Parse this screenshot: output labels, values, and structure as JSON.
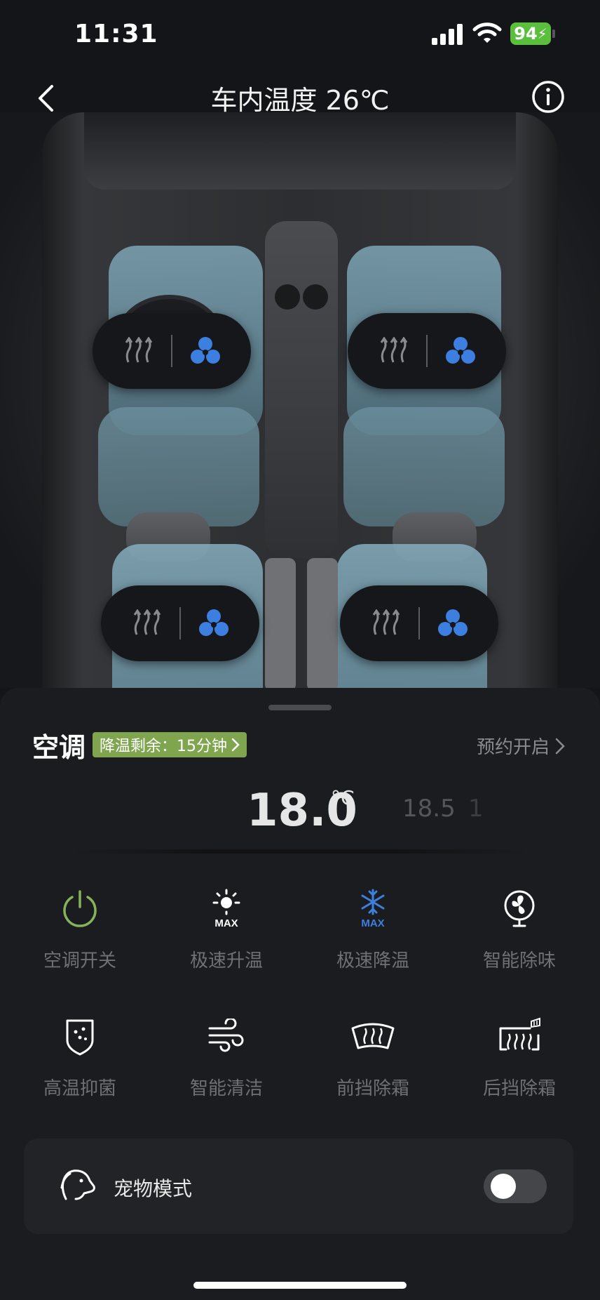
{
  "status_bar": {
    "time": "11:31",
    "battery": "94"
  },
  "header": {
    "title": "车内温度 26℃",
    "back_icon": "chevron-left-icon",
    "info_icon": "info-icon"
  },
  "seats": [
    {
      "position": "front-left",
      "heat_icon": "seat-heat-icon",
      "fan_icon": "seat-ventilation-icon",
      "fan_active": true
    },
    {
      "position": "front-right",
      "heat_icon": "seat-heat-icon",
      "fan_icon": "seat-ventilation-icon",
      "fan_active": true
    },
    {
      "position": "rear-left",
      "heat_icon": "seat-heat-icon",
      "fan_icon": "seat-ventilation-icon",
      "fan_active": true
    },
    {
      "position": "rear-right",
      "heat_icon": "seat-heat-icon",
      "fan_icon": "seat-ventilation-icon",
      "fan_active": true
    }
  ],
  "ac": {
    "title": "空调",
    "badge": "降温剩余：15分钟",
    "schedule": "预约开启",
    "temperature": {
      "current": "18.0",
      "unit": "°C",
      "next": "18.5",
      "next2": "1"
    }
  },
  "functions": [
    {
      "label": "空调开关",
      "icon": "power-icon",
      "color": "#86b35a"
    },
    {
      "label": "极速升温",
      "icon": "sun-max-icon",
      "color": "#ffffff"
    },
    {
      "label": "极速降温",
      "icon": "snowflake-max-icon",
      "color": "#3d7fe0"
    },
    {
      "label": "智能除味",
      "icon": "fan-icon",
      "color": "#ffffff"
    },
    {
      "label": "高温抑菌",
      "icon": "shield-germ-icon",
      "color": "#ffffff"
    },
    {
      "label": "智能清洁",
      "icon": "wind-icon",
      "color": "#ffffff"
    },
    {
      "label": "前挡除霜",
      "icon": "front-defrost-icon",
      "color": "#ffffff"
    },
    {
      "label": "后挡除霜",
      "icon": "rear-defrost-icon",
      "color": "#ffffff"
    }
  ],
  "pet_mode": {
    "label": "宠物模式",
    "icon": "pet-icon",
    "enabled": false
  },
  "colors": {
    "accent_blue": "#3d7fe0",
    "badge_green": "#7fa64f",
    "background": "#141518"
  }
}
